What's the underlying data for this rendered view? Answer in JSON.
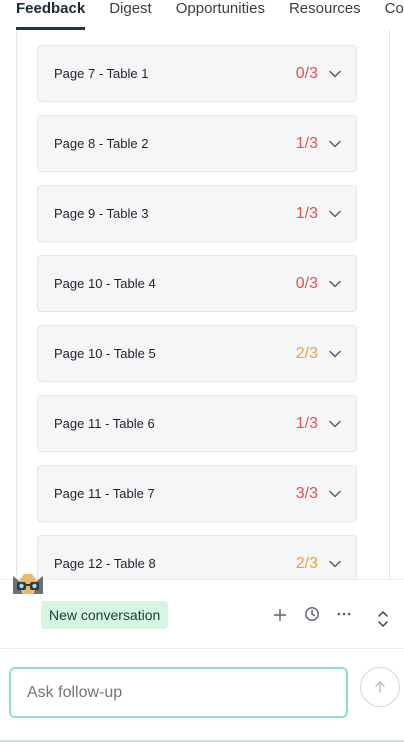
{
  "tabs": [
    {
      "label": "Feedback",
      "active": true
    },
    {
      "label": "Digest",
      "active": false
    },
    {
      "label": "Opportunities",
      "active": false
    },
    {
      "label": "Resources",
      "active": false
    },
    {
      "label": "Colle",
      "active": false
    }
  ],
  "tables": [
    {
      "label": "Page 7 - Table 1",
      "score": "0/3",
      "status": "low"
    },
    {
      "label": "Page 8 - Table 2",
      "score": "1/3",
      "status": "low"
    },
    {
      "label": "Page 9 - Table 3",
      "score": "1/3",
      "status": "low"
    },
    {
      "label": "Page 10 - Table 4",
      "score": "0/3",
      "status": "low"
    },
    {
      "label": "Page 10 - Table 5",
      "score": "2/3",
      "status": "mid"
    },
    {
      "label": "Page 11 - Table 6",
      "score": "1/3",
      "status": "low"
    },
    {
      "label": "Page 11 - Table 7",
      "score": "3/3",
      "status": "low"
    },
    {
      "label": "Page 12 - Table 8",
      "score": "2/3",
      "status": "mid"
    }
  ],
  "colors": {
    "score_low": "#e05252",
    "score_mid": "#e8a23a",
    "accent_green": "#8fe3b9",
    "new_convo_bg": "#d6f5e3"
  },
  "conversation": {
    "new_label": "New conversation",
    "input_placeholder": "Ask follow-up",
    "icons": [
      "plus-icon",
      "history-icon",
      "more-icon",
      "expand-collapse-icon",
      "send-arrow-icon"
    ]
  }
}
